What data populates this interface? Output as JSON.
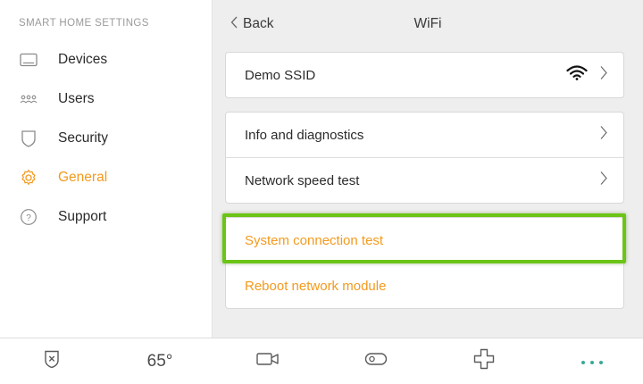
{
  "sidebar": {
    "title": "SMART HOME SETTINGS",
    "items": [
      {
        "label": "Devices",
        "icon": "tablet-icon"
      },
      {
        "label": "Users",
        "icon": "users-icon"
      },
      {
        "label": "Security",
        "icon": "shield-icon"
      },
      {
        "label": "General",
        "icon": "gear-icon",
        "active": true
      },
      {
        "label": "Support",
        "icon": "question-icon"
      }
    ]
  },
  "header": {
    "back_label": "Back",
    "title": "WiFi"
  },
  "network": {
    "ssid": "Demo SSID"
  },
  "options": [
    {
      "label": "Info and diagnostics"
    },
    {
      "label": "Network speed test"
    }
  ],
  "actions": [
    {
      "label": "System connection test",
      "highlighted": true
    },
    {
      "label": "Reboot network module"
    }
  ],
  "bottom_bar": {
    "temperature": "65°",
    "items": [
      "security-shield-icon",
      "temperature",
      "camera-icon",
      "toggle-icon",
      "plus-cross-icon",
      "more-dots-icon"
    ]
  },
  "colors": {
    "accent": "#f39a1e",
    "highlight": "#6cc417",
    "more_dots": "#3aa99a"
  }
}
